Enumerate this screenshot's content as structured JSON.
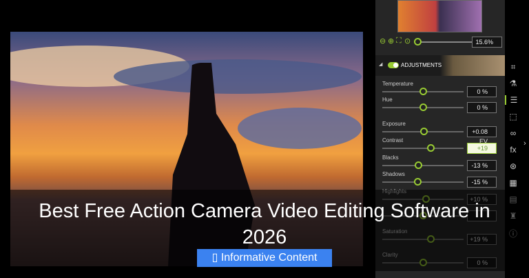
{
  "zoom": {
    "value": "15.6%"
  },
  "adjustments": {
    "title": "ADJUSTMENTS",
    "rows": [
      {
        "label": "Temperature",
        "value": "0 %",
        "pos": 0.5
      },
      {
        "label": "Hue",
        "value": "0 %",
        "pos": 0.5
      },
      {
        "label": "Exposure",
        "value": "+0.08 EV",
        "pos": 0.51
      },
      {
        "label": "Contrast",
        "value": "+19",
        "pos": 0.59
      },
      {
        "label": "Blacks",
        "value": "-13 %",
        "pos": 0.44
      },
      {
        "label": "Shadows",
        "value": "-15 %",
        "pos": 0.43
      },
      {
        "label": "Highlights",
        "value": "+10 %",
        "pos": 0.53
      },
      {
        "label": "",
        "value": "",
        "pos": 0.5
      },
      {
        "label": "Saturation",
        "value": "+19 %",
        "pos": 0.59
      },
      {
        "label": "Clarity",
        "value": "0 %",
        "pos": 0.5
      }
    ]
  },
  "icons": [
    "crop-icon",
    "flask-icon",
    "sliders-icon",
    "selection-icon",
    "glasses-icon",
    "fx-icon",
    "color-circles-icon",
    "grid-icon",
    "document-icon",
    "stamp-icon",
    "info-icon"
  ],
  "article": {
    "title": "Best Free Action Camera Video Editing Software in 2026",
    "badge": "Informative Content",
    "badge_color": "#3b82f0"
  }
}
